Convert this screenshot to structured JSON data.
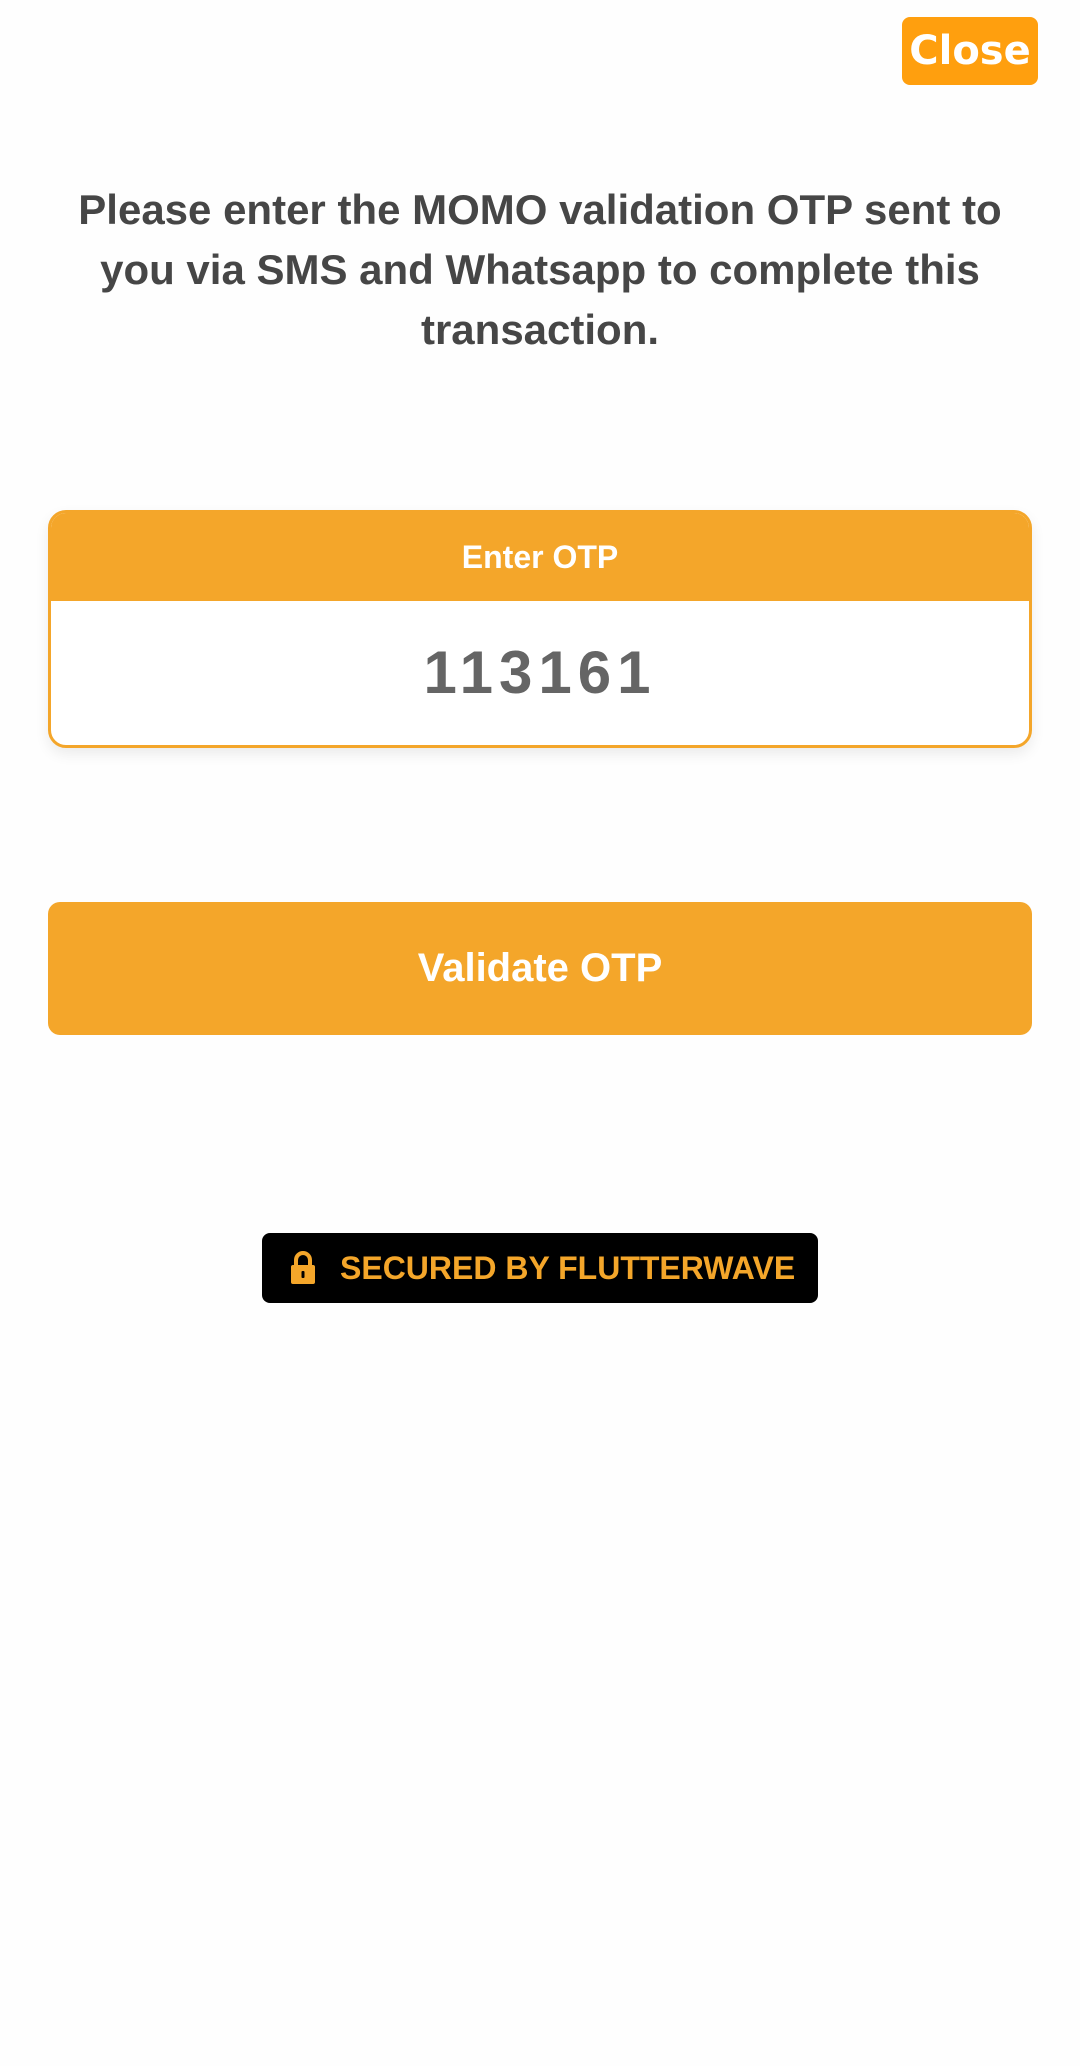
{
  "header": {
    "close_label": "Close"
  },
  "main": {
    "instruction": "Please enter the MOMO validation OTP sent to you via SMS and Whatsapp to complete this transaction.",
    "otp_label": "Enter OTP",
    "otp_value": "113161",
    "validate_label": "Validate OTP"
  },
  "footer": {
    "secured_text": "SECURED BY FLUTTERWAVE",
    "lock_icon": "lock-icon"
  },
  "colors": {
    "accent": "#f4a62a",
    "close_button": "#ff9f0e",
    "text": "#464646",
    "badge_background": "#000000"
  }
}
